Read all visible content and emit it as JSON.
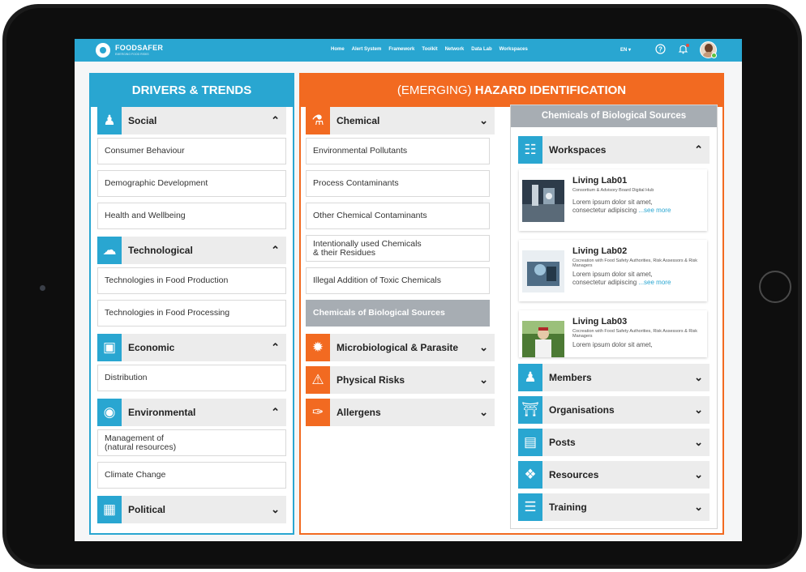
{
  "brand": {
    "name": "FOODSAFER",
    "tagline": "EMERGING FOOD RISKS"
  },
  "nav": [
    "Home",
    "Alert System",
    "Framework",
    "Toolkit",
    "Network",
    "Data Lab",
    "Workspaces"
  ],
  "lang": "EN ▾",
  "icons": {
    "help": "help-circle-icon",
    "bell": "bell-icon",
    "avatar": "user-avatar"
  },
  "drivers": {
    "title": "DRIVERS & TRENDS",
    "sections": [
      {
        "label": "Social",
        "icon": "people-icon",
        "expanded": true,
        "items": [
          "Consumer Behaviour",
          "Demographic Development",
          "Health and Wellbeing"
        ]
      },
      {
        "label": "Technological",
        "icon": "cloud-gear-icon",
        "expanded": true,
        "items": [
          "Technologies in Food Production",
          "Technologies in Food Processing"
        ]
      },
      {
        "label": "Economic",
        "icon": "money-icon",
        "expanded": true,
        "items": [
          "Distribution"
        ]
      },
      {
        "label": "Environmental",
        "icon": "globe-icon",
        "expanded": true,
        "items": [
          "Management of\n(natural resources)",
          "Climate Change"
        ]
      },
      {
        "label": "Political",
        "icon": "document-icon",
        "expanded": false,
        "items": []
      }
    ]
  },
  "hazard": {
    "title_prefix": "(EMERGING) ",
    "title_main": "HAZARD IDENTIFICATION",
    "sections": [
      {
        "label": "Chemical",
        "icon": "flask-icon",
        "expanded": true,
        "items": [
          "Environmental Pollutants",
          "Process Contaminants",
          "Other Chemical Contaminants",
          "Intentionally used Chemicals\n& their Residues",
          "Illegal Addition of Toxic Chemicals",
          "Chemicals of Biological Sources"
        ],
        "active_index": 5
      },
      {
        "label": "Microbiological & Parasite",
        "icon": "virus-icon",
        "expanded": false
      },
      {
        "label": "Physical Risks",
        "icon": "warning-icon",
        "expanded": false
      },
      {
        "label": "Allergens",
        "icon": "syringe-icon",
        "expanded": false
      }
    ]
  },
  "right": {
    "title": "Chemicals of Biological Sources",
    "workspaces_label": "Workspaces",
    "labs": [
      {
        "title": "Living Lab01",
        "sub": "Consortium & Advisory Board Digital Hub",
        "desc": "Lorem ipsum dolor sit amet,",
        "desc2": "consectetur adipiscing",
        "more": "...see more"
      },
      {
        "title": "Living Lab02",
        "sub": "Cocreation with Food Safety Authorities, Risk Assessors & Risk Managers",
        "desc": "Lorem ipsum dolor sit amet,",
        "desc2": "consectetur adipiscing",
        "more": "...see more"
      },
      {
        "title": "Living Lab03",
        "sub": "Cocreation with Food Safety Authorities, Risk Assessors & Risk Managers",
        "desc": "Lorem ipsum dolor sit amet,",
        "desc2": "",
        "more": ""
      }
    ],
    "sections": [
      {
        "label": "Members",
        "icon": "members-icon"
      },
      {
        "label": "Organisations",
        "icon": "building-icon"
      },
      {
        "label": "Posts",
        "icon": "posts-icon"
      },
      {
        "label": "Resources",
        "icon": "tag-icon"
      },
      {
        "label": "Training",
        "icon": "books-icon"
      }
    ]
  },
  "colors": {
    "blue": "#29a6d1",
    "orange": "#f26a21",
    "grey": "#a7adb3"
  }
}
